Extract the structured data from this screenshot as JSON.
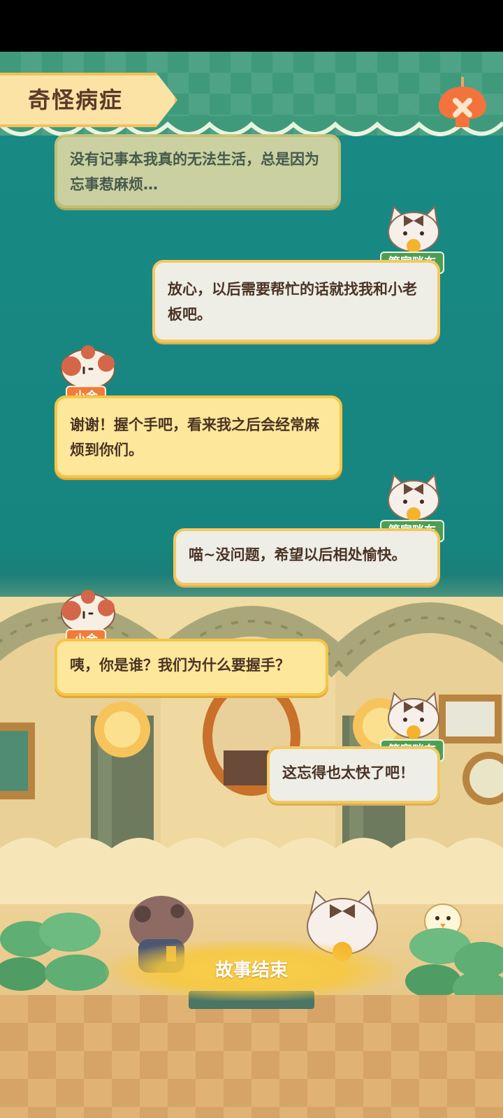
{
  "header": {
    "title": "奇怪病症",
    "close_icon": "close-icon"
  },
  "dialogue": [
    {
      "speaker": "",
      "side": "left",
      "style": "faded",
      "text": "没有记事本我真的无法生活，总是因为忘事惹麻烦…"
    },
    {
      "speaker": "管家咪布",
      "side": "right",
      "text": "放心，以后需要帮忙的话就找我和小老板吧。"
    },
    {
      "speaker": "小金",
      "side": "left",
      "text": "谢谢！握个手吧，看来我之后会经常麻烦到你们。"
    },
    {
      "speaker": "管家咪布",
      "side": "right",
      "text": "喵~没问题，希望以后相处愉快。"
    },
    {
      "speaker": "小金",
      "side": "left",
      "text": "咦，你是谁？我们为什么要握手？"
    },
    {
      "speaker": "管家咪布",
      "side": "right",
      "text": "这忘得也太快了吧！"
    }
  ],
  "actions": {
    "story_end_label": "故事结束"
  },
  "colors": {
    "teal_background": "#198a84",
    "left_bubble": "#fde79a",
    "right_bubble": "#eeeee7",
    "orange_tag": "#f27a3a",
    "green_tag": "#4d9e52"
  }
}
